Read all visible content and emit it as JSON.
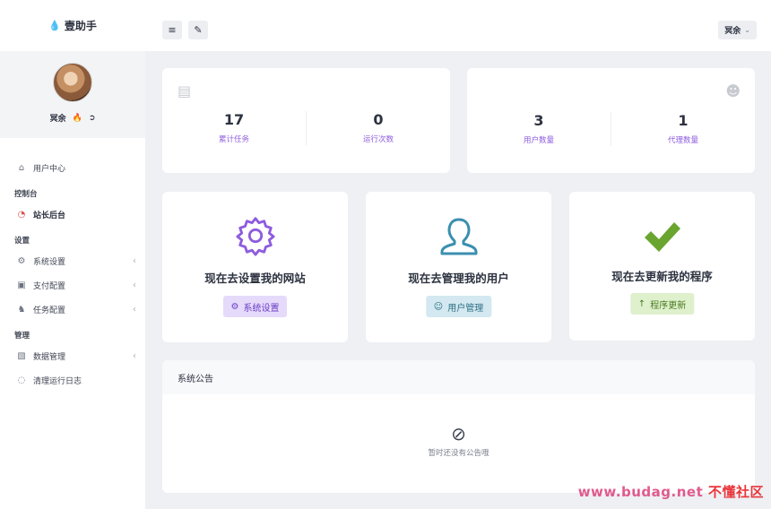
{
  "brand": {
    "name": "壹助手",
    "icon": "flame-icon"
  },
  "user": {
    "name": "冥余",
    "icons": [
      "flame-icon",
      "logout-icon"
    ]
  },
  "sidebar": {
    "items": [
      {
        "label": "用户中心",
        "icon": "home-icon"
      }
    ],
    "sections": [
      {
        "title": "控制台",
        "items": [
          {
            "label": "站长后台",
            "icon": "dashboard-icon",
            "active": true
          }
        ]
      },
      {
        "title": "设置",
        "items": [
          {
            "label": "系统设置",
            "icon": "gear-icon",
            "caret": "‹"
          },
          {
            "label": "支付配置",
            "icon": "money-icon",
            "caret": "‹"
          },
          {
            "label": "任务配置",
            "icon": "horse-icon",
            "caret": "‹"
          }
        ]
      },
      {
        "title": "管理",
        "items": [
          {
            "label": "数据管理",
            "icon": "bar-chart-icon",
            "caret": "‹"
          },
          {
            "label": "清理运行日志",
            "icon": "spinner-icon"
          }
        ]
      }
    ]
  },
  "header": {
    "menu_icon": "menu-icon",
    "brush_icon": "brush-icon",
    "user": "冥余",
    "caret": "⌄"
  },
  "stats_left": [
    {
      "value": "17",
      "label": "累计任务"
    },
    {
      "value": "0",
      "label": "运行次数"
    }
  ],
  "stats_right": [
    {
      "value": "3",
      "label": "用户数量"
    },
    {
      "value": "1",
      "label": "代理数量"
    }
  ],
  "actions": [
    {
      "title": "现在去设置我的网站",
      "button": "系统设置",
      "icon": "gear-icon",
      "btn_icon": "gear-icon",
      "color": "#8e5cde"
    },
    {
      "title": "现在去管理我的用户",
      "button": "用户管理",
      "icon": "user-icon",
      "btn_icon": "users-icon",
      "color": "#3b8fb0"
    },
    {
      "title": "现在去更新我的程序",
      "button": "程序更新",
      "icon": "check-icon",
      "btn_icon": "arrow-up-icon",
      "color": "#6aa52f"
    }
  ],
  "notice": {
    "title": "系统公告",
    "empty_text": "暂时还没有公告哦",
    "empty_icon": "no-entry-icon"
  },
  "watermark": {
    "site": "www.budag.net",
    "name": "不懂社区"
  }
}
